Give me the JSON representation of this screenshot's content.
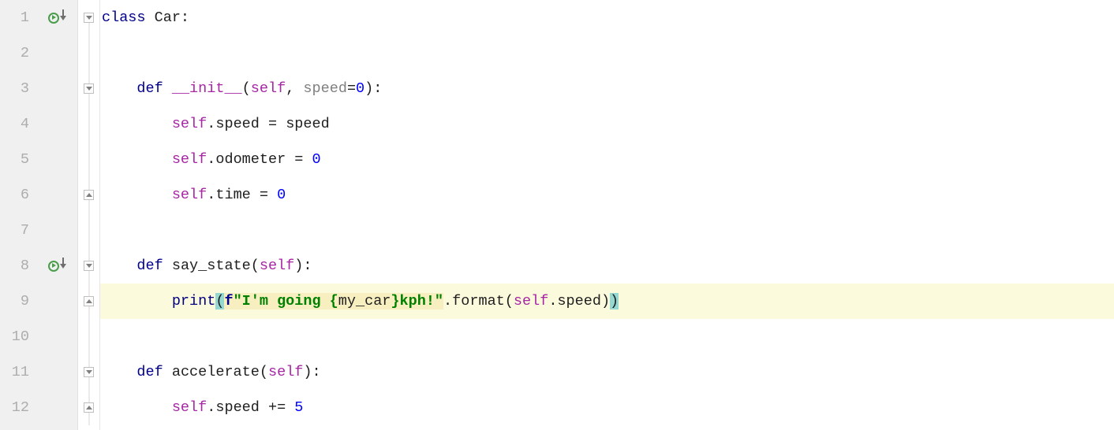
{
  "lines": {
    "l1": {
      "num": "1"
    },
    "l2": {
      "num": "2"
    },
    "l3": {
      "num": "3"
    },
    "l4": {
      "num": "4"
    },
    "l5": {
      "num": "5"
    },
    "l6": {
      "num": "6"
    },
    "l7": {
      "num": "7"
    },
    "l8": {
      "num": "8"
    },
    "l9": {
      "num": "9"
    },
    "l10": {
      "num": "10"
    },
    "l11": {
      "num": "11"
    },
    "l12": {
      "num": "12"
    }
  },
  "code": {
    "indent4": "    ",
    "indent8": "        ",
    "kw_class": "class ",
    "name_Car": "Car:",
    "kw_def": "def ",
    "name_init": "__init__",
    "lparen": "(",
    "rparen": ")",
    "colon": ":",
    "kw_self": "self",
    "comma_sp": ", ",
    "param_speed": "speed",
    "eq": "=",
    "eq_sp": " = ",
    "pluseq_sp": " += ",
    "zero": "0",
    "five": "5",
    "dot": ".",
    "attr_speed": "speed",
    "attr_odometer": "odometer",
    "attr_time": "time",
    "name_saystate": "say_state",
    "name_accelerate": "accelerate",
    "fn_print": "print",
    "f_prefix": "f",
    "str_part1": "\"I'm going {",
    "str_mycar": "my_car",
    "str_part2": "}kph!\"",
    "fn_format": "format"
  }
}
